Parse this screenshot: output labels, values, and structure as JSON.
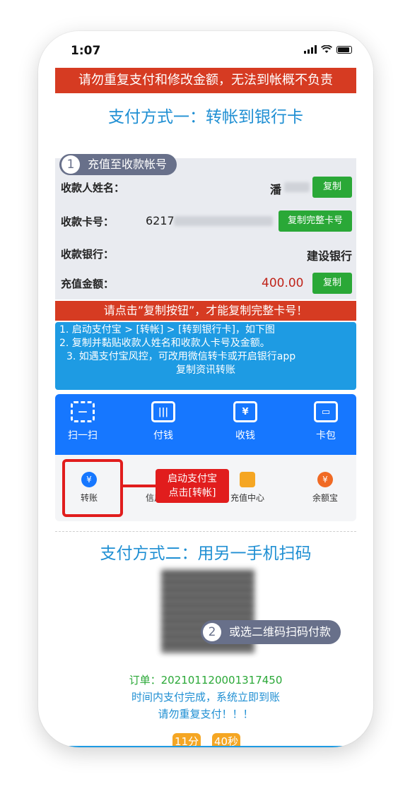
{
  "status_bar": {
    "time": "1:07"
  },
  "warning": "请勿重复支付和修改金额，无法到帐概不负责",
  "method_one": {
    "title": "支付方式一：转帐到银行卡",
    "step_number": "1",
    "step_label": "充值至收款帐号",
    "payee_name_label": "收款人姓名：",
    "payee_name_value": "潘",
    "copy_label": "复制",
    "card_label": "收款卡号：",
    "card_value": "6217",
    "copy_full_card_label": "复制完整卡号",
    "bank_label": "收款银行：",
    "bank_value": "建设银行",
    "amount_label": "充值金额：",
    "amount_value": "400.00"
  },
  "copy_tip": "请点击”复制按钮”，才能复制完整卡号！",
  "steps": [
    "1. 启动支付宝 > [转帐] > [转到银行卡]，如下图",
    "2. 复制并黏贴收款人姓名和收款人卡号及金额。",
    "3. 如遇支付宝风控，可改用微信转卡或开启银行app",
    "复制资讯转账"
  ],
  "alipay": {
    "top_items": [
      {
        "label": "扫一扫",
        "icon": "scan-icon"
      },
      {
        "label": "付钱",
        "icon": "pay-code-icon"
      },
      {
        "label": "收钱",
        "icon": "receive-money-icon"
      },
      {
        "label": "卡包",
        "icon": "card-wallet-icon"
      }
    ],
    "bottom_items": [
      {
        "label": "转账",
        "icon": "transfer-icon"
      },
      {
        "label": "信用卡还款",
        "icon": "credit-card-icon"
      },
      {
        "label": "充值中心",
        "icon": "recharge-icon"
      },
      {
        "label": "余额宝",
        "icon": "yuebao-icon"
      }
    ],
    "callout_line1": "启动支付宝",
    "callout_line2": "点击[转帐]"
  },
  "method_two": {
    "title": "支付方式二：用另一手机扫码",
    "step_number": "2",
    "step_label": "或选二维码扫码付款"
  },
  "order": {
    "label": "订单：202101120001317450",
    "line2": "时间内支付完成，系统立即到账",
    "line3": "请勿重复支付！！！"
  },
  "timer": {
    "minutes": "11分",
    "seconds": "40秒"
  },
  "colors": {
    "brand_blue": "#1f8fd3",
    "alert_red": "#d63b22",
    "copy_green": "#2aa837",
    "alipay_blue": "#1677ff",
    "timer_orange": "#f5a623"
  }
}
